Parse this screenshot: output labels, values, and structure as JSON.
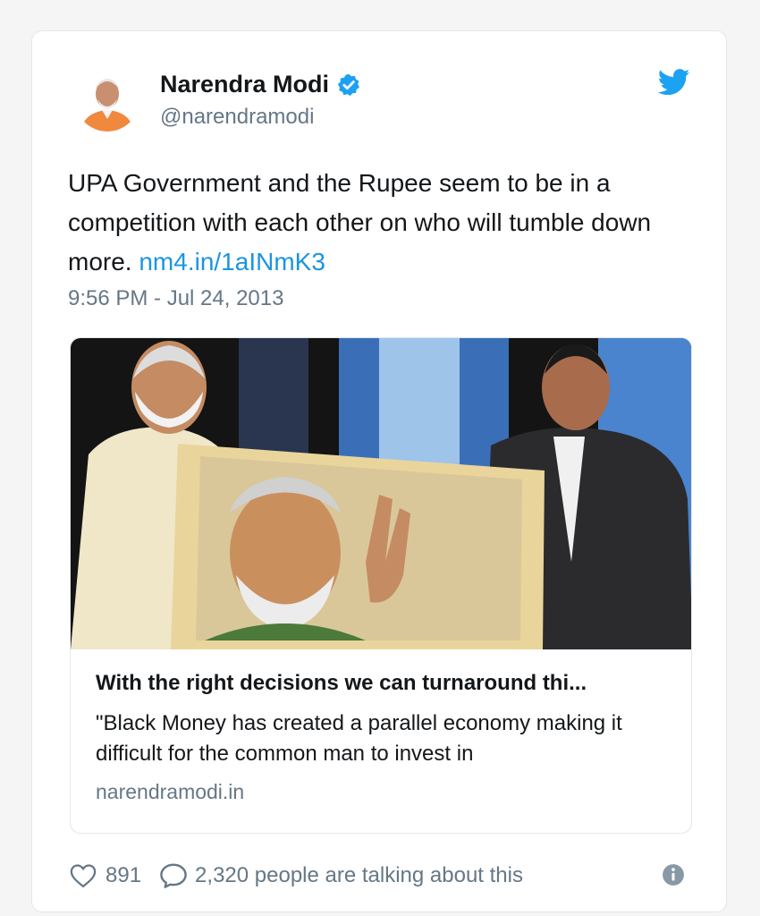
{
  "author": {
    "name": "Narendra Modi",
    "handle": "@narendramodi"
  },
  "tweet": {
    "text": "UPA Government and the Rupee seem to be in a competition with each other on who will tumble down more.",
    "link": "nm4.in/1aINmK3",
    "timestamp": "9:56 PM - Jul 24, 2013"
  },
  "link_preview": {
    "title": "With the right decisions we can turnaround thi...",
    "description": "\"Black Money has created a parallel economy making it difficult for the common man to invest in",
    "domain": "narendramodi.in"
  },
  "footer": {
    "likes": "891",
    "conversation": "2,320 people are talking about this"
  },
  "icons": {
    "verified": "verified-badge-icon",
    "brand": "twitter-bird-icon",
    "like": "heart-icon",
    "reply": "speech-bubble-icon",
    "info": "info-icon"
  },
  "colors": {
    "accent": "#1da1f2",
    "link": "#1b95e0",
    "muted": "#657786",
    "text": "#14171a"
  }
}
